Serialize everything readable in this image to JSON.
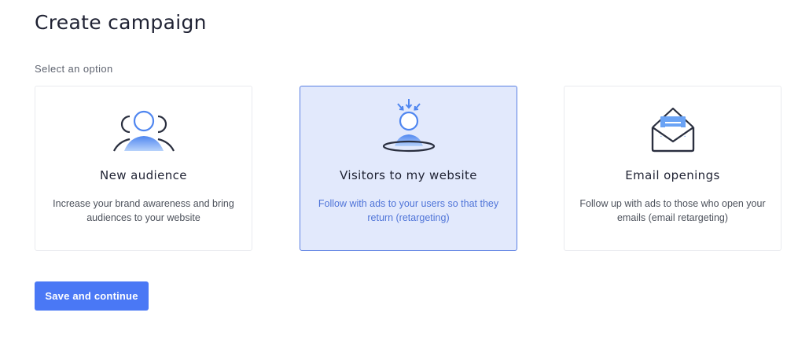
{
  "page": {
    "title": "Create campaign",
    "subtitle": "Select an option"
  },
  "options": [
    {
      "title": "New audience",
      "description": "Increase your brand awareness and bring audiences to your website",
      "icon": "audience-group-icon",
      "selected": false
    },
    {
      "title": "Visitors to my website",
      "description": "Follow with ads to your users so that they return (retargeting)",
      "icon": "website-visitor-icon",
      "selected": true
    },
    {
      "title": "Email openings",
      "description": "Follow up with ads to those who open your emails (email retargeting)",
      "icon": "open-envelope-icon",
      "selected": false
    }
  ],
  "actions": {
    "save_label": "Save and continue"
  },
  "colors": {
    "accent": "#4a78f5",
    "selected_bg": "#e2e9fc",
    "selected_border": "#5a7fe3",
    "icon_stroke": "#2a2f3f",
    "icon_fill": "#6aa3f5"
  }
}
